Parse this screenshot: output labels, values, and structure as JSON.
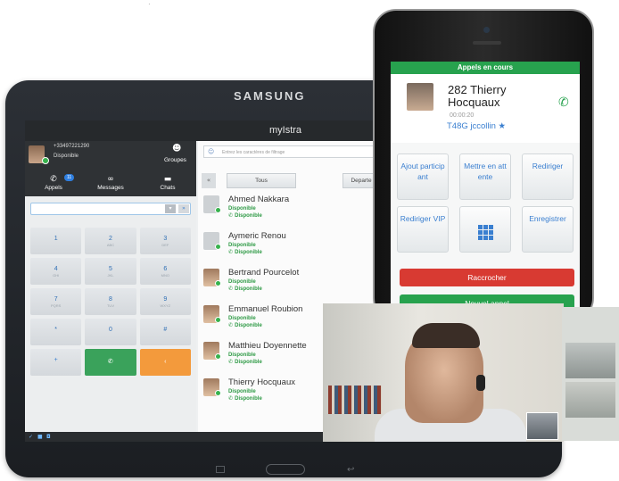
{
  "tablet": {
    "brand": "SAMSUNG",
    "app_title": "myIstra",
    "account": {
      "number": "+33497221290",
      "status": "Disponible"
    },
    "groups_label": "Groupes",
    "tabs": [
      {
        "label": "Appels",
        "badge": "11",
        "icon": "phone-icon"
      },
      {
        "label": "Messages",
        "icon": "voicemail-icon"
      },
      {
        "label": "Chats",
        "icon": "chat-icon"
      }
    ],
    "dialpad": [
      {
        "digit": "1",
        "letters": ""
      },
      {
        "digit": "2",
        "letters": "ABC"
      },
      {
        "digit": "3",
        "letters": "DEF"
      },
      {
        "digit": "4",
        "letters": "GHI"
      },
      {
        "digit": "5",
        "letters": "JKL"
      },
      {
        "digit": "6",
        "letters": "MNO"
      },
      {
        "digit": "7",
        "letters": "PQRS"
      },
      {
        "digit": "8",
        "letters": "TUV"
      },
      {
        "digit": "9",
        "letters": "WXYZ"
      },
      {
        "digit": "*",
        "letters": ""
      },
      {
        "digit": "0",
        "letters": ""
      },
      {
        "digit": "#",
        "letters": ""
      }
    ],
    "search_placeholder": "Entrez les caractères de filtrage",
    "filter_tabs": [
      "Tous",
      "Departe"
    ],
    "contacts": [
      {
        "name": "Ahmed Nakkara",
        "status": "Disponible",
        "phone_status": "Disponible",
        "has_photo": false
      },
      {
        "name": "Aymeric Renou",
        "status": "Disponible",
        "phone_status": "Disponible",
        "has_photo": false
      },
      {
        "name": "Bertrand Pourcelot",
        "status": "Disponible",
        "phone_status": "Disponible",
        "has_photo": true
      },
      {
        "name": "Emmanuel Roubion",
        "status": "Disponible",
        "phone_status": "Disponible",
        "has_photo": true
      },
      {
        "name": "Matthieu Doyennette",
        "status": "Disponible",
        "phone_status": "Disponible",
        "has_photo": true
      },
      {
        "name": "Thierry Hocquaux",
        "status": "Disponible",
        "phone_status": "Disponible",
        "has_photo": true
      }
    ]
  },
  "phone": {
    "title": "Appels en cours",
    "caller_name": "282 Thierry Hocquaux",
    "duration": "00:00:20",
    "caller_info": "T48G jccollin ★",
    "actions": [
      "Ajout participant",
      "Mettre en attente",
      "Rediriger",
      "Rediriger VIP",
      "",
      "Enregistrer"
    ],
    "hangup_label": "Raccrocher",
    "new_call_label": "Nouvel appel"
  },
  "colors": {
    "green": "#27a24e",
    "red": "#d83a32",
    "blue": "#3a7fd0",
    "orange": "#f39a3c"
  }
}
